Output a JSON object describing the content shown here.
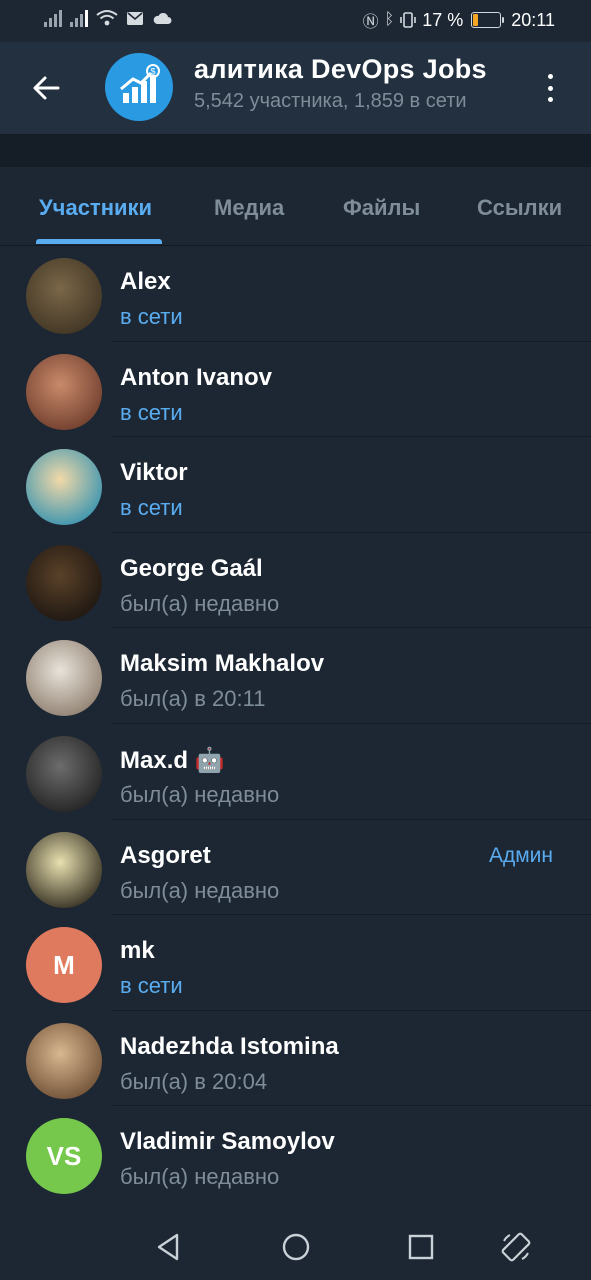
{
  "statusbar": {
    "battery_percent": "17 %",
    "time": "20:11"
  },
  "header": {
    "title": "Аналитика    DevOps Jobs",
    "title_visible": "алитика    DevOps Jobs",
    "subtitle": "5,542 участника, 1,859 в сети"
  },
  "tabs": [
    {
      "label": "Участники",
      "active": true
    },
    {
      "label": "Медиа",
      "active": false
    },
    {
      "label": "Файлы",
      "active": false
    },
    {
      "label": "Ссылки",
      "active": false
    }
  ],
  "members": [
    {
      "name": "Alex",
      "status": "в сети",
      "online": true,
      "role": "",
      "avatar_colors": [
        "#7b6748",
        "#3d3222"
      ]
    },
    {
      "name": "Anton Ivanov",
      "status": "в сети",
      "online": true,
      "role": "",
      "avatar_colors": [
        "#c98a6a",
        "#6b3a2a"
      ]
    },
    {
      "name": "Viktor",
      "status": "в сети",
      "online": true,
      "role": "",
      "avatar_colors": [
        "#f2d9a8",
        "#2d8fb0"
      ]
    },
    {
      "name": "George Gaál",
      "status": "был(а) недавно",
      "online": false,
      "role": "",
      "avatar_colors": [
        "#5a4128",
        "#1a1410"
      ]
    },
    {
      "name": "Maksim Makhalov",
      "status": "был(а) в 20:11",
      "online": false,
      "role": "",
      "avatar_colors": [
        "#e8e3da",
        "#8a7a6a"
      ]
    },
    {
      "name": "Max.d 🤖",
      "status": "был(а) недавно",
      "online": false,
      "role": "",
      "avatar_colors": [
        "#6c6c6c",
        "#1f1f1f"
      ]
    },
    {
      "name": "Asgoret",
      "status": "был(а) недавно",
      "online": false,
      "role": "Админ",
      "avatar_colors": [
        "#e8e0b0",
        "#2a2418"
      ]
    },
    {
      "name": "mk",
      "status": "в сети",
      "online": true,
      "role": "",
      "avatar_letter": "M",
      "avatar_colors": [
        "#e07a5f",
        "#e07a5f"
      ]
    },
    {
      "name": "Nadezhda Istomina",
      "status": "был(а) в 20:04",
      "online": false,
      "role": "",
      "avatar_colors": [
        "#d8b890",
        "#6a4a30"
      ]
    },
    {
      "name": "Vladimir Samoylov",
      "status": "был(а) недавно",
      "online": false,
      "role": "",
      "avatar_letter": "VS",
      "avatar_colors": [
        "#76c84d",
        "#76c84d"
      ]
    }
  ],
  "colors": {
    "accent": "#5aacf1",
    "background": "#1c2733",
    "header": "#22303f"
  }
}
